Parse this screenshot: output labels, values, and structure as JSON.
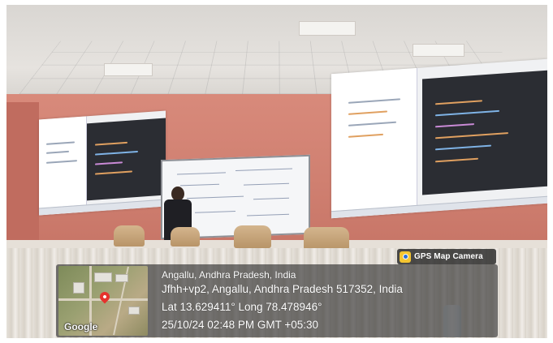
{
  "badge": {
    "icon": "map-pin-icon",
    "label": "GPS Map Camera"
  },
  "map": {
    "provider_label": "Google"
  },
  "location": {
    "place": "Angallu, Andhra Pradesh, India",
    "address": "Jfhh+vp2, Angallu, Andhra Pradesh 517352, India",
    "coordinates": "Lat 13.629411° Long 78.478946°",
    "timestamp": "25/10/24 02:48 PM GMT +05:30"
  },
  "colors": {
    "wall": "#d88a7b",
    "badge_icon": "#f4c531",
    "pin": "#e5322d"
  }
}
